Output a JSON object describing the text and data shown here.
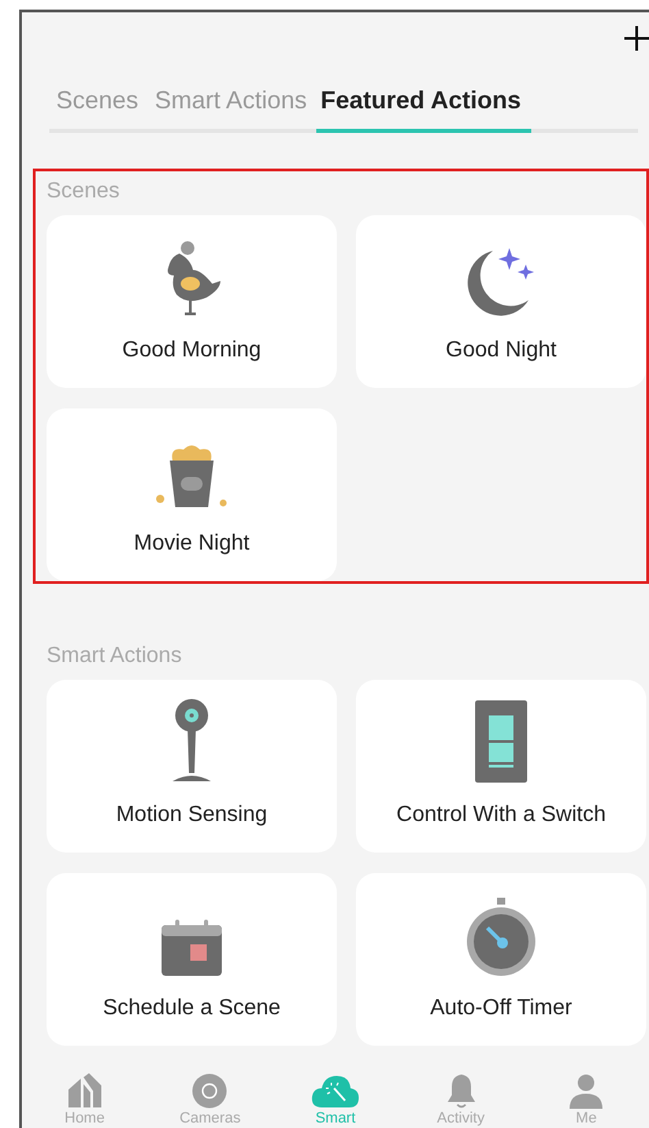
{
  "tabs": [
    {
      "label": "Scenes",
      "selected": false
    },
    {
      "label": "Smart Actions",
      "selected": false
    },
    {
      "label": "Featured Actions",
      "selected": true
    }
  ],
  "sections": [
    {
      "title": "Scenes",
      "highlighted": true,
      "cards": [
        {
          "label": "Good Morning"
        },
        {
          "label": "Good Night"
        },
        {
          "label": "Movie Night"
        }
      ]
    },
    {
      "title": "Smart Actions",
      "highlighted": false,
      "cards": [
        {
          "label": "Motion Sensing"
        },
        {
          "label": "Control With a Switch"
        },
        {
          "label": "Schedule a Scene"
        },
        {
          "label": "Auto-Off Timer"
        }
      ]
    }
  ],
  "nav": [
    {
      "label": "Home",
      "selected": false
    },
    {
      "label": "Cameras",
      "selected": false
    },
    {
      "label": "Smart",
      "selected": true
    },
    {
      "label": "Activity",
      "selected": false
    },
    {
      "label": "Me",
      "selected": false
    }
  ]
}
